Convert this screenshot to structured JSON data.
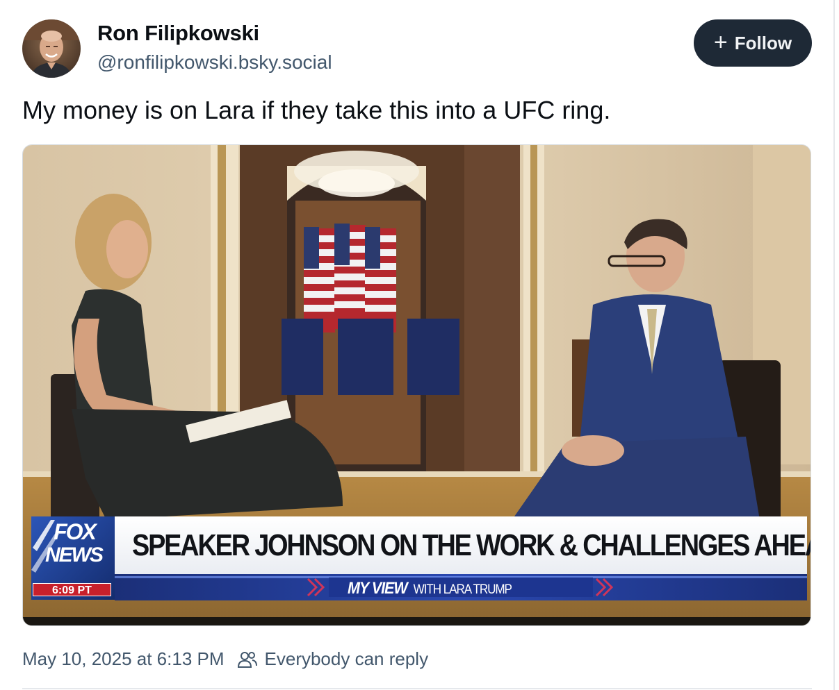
{
  "post": {
    "author": {
      "display_name": "Ron Filipkowski",
      "handle": "@ronfilipkowski.bsky.social"
    },
    "follow_button": {
      "icon": "plus-icon",
      "label": "Follow"
    },
    "text": "My money is on Lara if they take this into a UFC ring.",
    "media": {
      "network_logo_top": "FOX",
      "network_logo_bottom": "NEWS",
      "time": "6:09 PT",
      "headline": "SPEAKER JOHNSON ON THE WORK & CHALLENGES AHEAD",
      "show_title": "MY VIEW",
      "show_host": "WITH LARA TRUMP"
    },
    "timestamp": "May 10, 2025 at 6:13 PM",
    "reply_setting": {
      "icon": "people-icon",
      "label": "Everybody can reply"
    }
  },
  "colors": {
    "follow_bg": "#1e2936",
    "secondary_text": "#42576c",
    "fox_blue": "#1f3f8f",
    "fox_red": "#c8202b"
  }
}
